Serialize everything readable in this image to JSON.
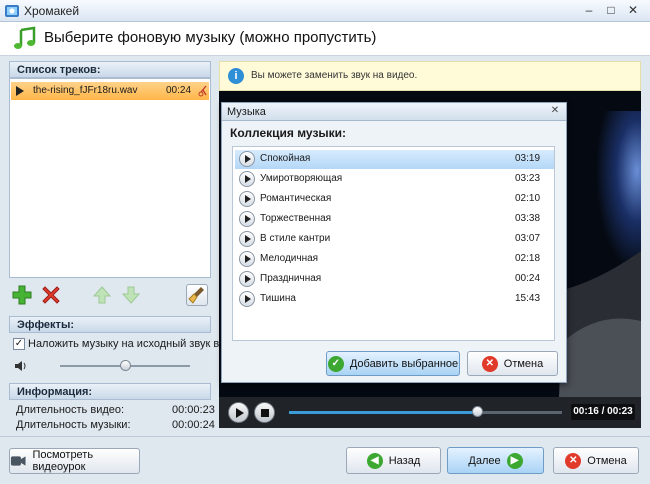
{
  "window": {
    "title": "Хромакей"
  },
  "header": {
    "title": "Выберите фоновую музыку (можно пропустить)"
  },
  "tracks": {
    "heading": "Список треков:",
    "items": [
      {
        "name": "the-rising_fJFr18ru.wav",
        "duration": "00:24"
      }
    ]
  },
  "effects": {
    "heading": "Эффекты:",
    "overlay_label": "Наложить музыку на исходный звук видео",
    "overlay_checked": true,
    "volume_level": 0.5
  },
  "info": {
    "heading": "Информация:",
    "video_label": "Длительность видео:",
    "video_value": "00:00:23",
    "music_label": "Длительность музыки:",
    "music_value": "00:00:24"
  },
  "notice": "Вы можете заменить звук на видео.",
  "dialog": {
    "title": "Музыка",
    "heading": "Коллекция музыки:",
    "items": [
      {
        "name": "Спокойная",
        "duration": "03:19",
        "selected": true
      },
      {
        "name": "Умиротворяющая",
        "duration": "03:23"
      },
      {
        "name": "Романтическая",
        "duration": "02:10"
      },
      {
        "name": "Торжественная",
        "duration": "03:38"
      },
      {
        "name": "В стиле кантри",
        "duration": "03:07"
      },
      {
        "name": "Мелодичная",
        "duration": "02:18"
      },
      {
        "name": "Праздничная",
        "duration": "00:24"
      },
      {
        "name": "Тишина",
        "duration": "15:43"
      }
    ],
    "add_label": "Добавить выбранное",
    "cancel_label": "Отмена"
  },
  "player": {
    "time": "00:16 / 00:23",
    "progress": 0.69
  },
  "footer": {
    "tutorial_label": "Посмотреть видеоурок",
    "back_label": "Назад",
    "next_label": "Далее",
    "cancel_label": "Отмена"
  },
  "colors": {
    "accent": "#3b9cd9",
    "selected_track": "#ffb548",
    "video_bg": "#050a12"
  }
}
